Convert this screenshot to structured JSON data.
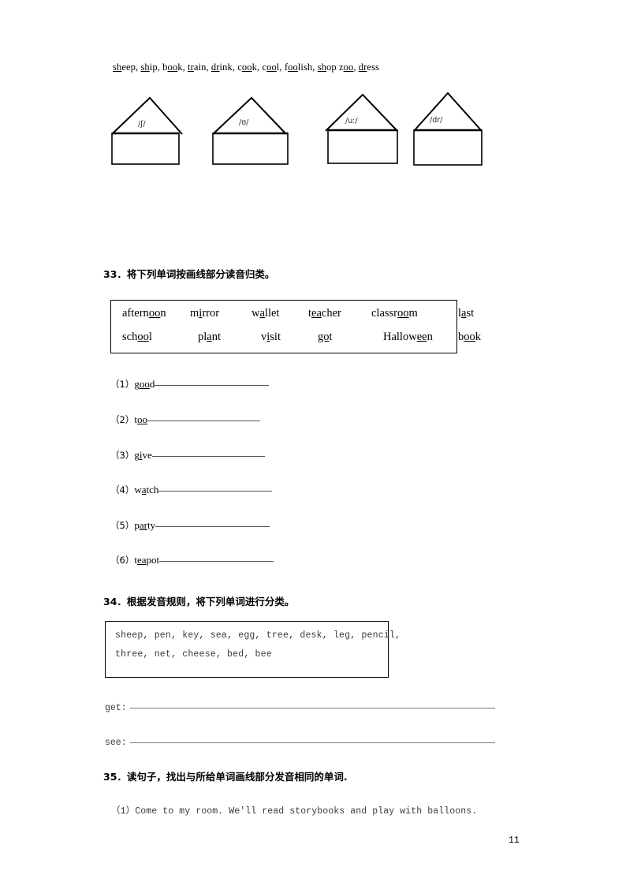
{
  "page": {
    "number": "11"
  },
  "top_word_list": {
    "name": "phonics-word-list",
    "words": [
      {
        "pre": "",
        "mark": "sh",
        "post": "eep",
        "sep": ", "
      },
      {
        "pre": "",
        "mark": "sh",
        "post": "ip",
        "sep": ", "
      },
      {
        "pre": "b",
        "mark": "oo",
        "post": "k",
        "sep": ", "
      },
      {
        "pre": "",
        "mark": "tr",
        "post": "ain",
        "sep": ", "
      },
      {
        "pre": "",
        "mark": "dr",
        "post": "ink",
        "sep": ", "
      },
      {
        "pre": "c",
        "mark": "oo",
        "post": "k",
        "sep": ", "
      },
      {
        "pre": "c",
        "mark": "oo",
        "post": "l",
        "sep": ", "
      },
      {
        "pre": "f",
        "mark": "oo",
        "post": "lish",
        "sep": ", "
      },
      {
        "pre": "",
        "mark": "sh",
        "post": "op",
        "sep": " "
      },
      {
        "pre": "z",
        "mark": "oo",
        "post": "",
        "sep": ", "
      },
      {
        "pre": "",
        "mark": "dr",
        "post": "ess",
        "sep": ""
      }
    ]
  },
  "houses": [
    {
      "name": "house-1",
      "phonetic": "/ʃ/"
    },
    {
      "name": "house-2",
      "phonetic": "/ʊ/"
    },
    {
      "name": "house-3",
      "phonetic": "/uː/"
    },
    {
      "name": "house-4",
      "phonetic": "/dr/"
    }
  ],
  "questions": {
    "q33": {
      "heading": "33．将下列单词按画线部分读音归类。",
      "word_bank": {
        "row1": [
          {
            "pre": "aftern",
            "mark": "oo",
            "post": "n"
          },
          {
            "pre": "m",
            "mark": "i",
            "post": "rror"
          },
          {
            "pre": "w",
            "mark": "a",
            "post": "llet"
          },
          {
            "pre": "t",
            "mark": "ea",
            "post": "cher"
          },
          {
            "pre": "classr",
            "mark": "oo",
            "post": "m"
          },
          {
            "pre": "l",
            "mark": "a",
            "post": "st"
          }
        ],
        "row2": [
          {
            "pre": "sch",
            "mark": "oo",
            "post": "l"
          },
          {
            "pre": "pl",
            "mark": "a",
            "post": "nt"
          },
          {
            "pre": "v",
            "mark": "i",
            "post": "sit"
          },
          {
            "pre": "",
            "mark": "go",
            "post": "t"
          },
          {
            "pre": "Hallow",
            "mark": "ee",
            "post": "n"
          },
          {
            "pre": "b",
            "mark": "oo",
            "post": "k"
          }
        ]
      },
      "items": [
        {
          "num": "（1）",
          "pre": "g",
          "mark": "oo",
          "post": "d",
          "rule_width": 145
        },
        {
          "num": "（2）",
          "pre": "t",
          "mark": "oo",
          "post": "",
          "rule_width": 143
        },
        {
          "num": "（3）",
          "pre": "g",
          "mark": "i",
          "post": "ve",
          "rule_width": 143
        },
        {
          "num": "（4）",
          "pre": "w",
          "mark": "a",
          "post": "tch",
          "rule_width": 144
        },
        {
          "num": "（5）",
          "pre": "p",
          "mark": "ar",
          "post": "ty",
          "rule_width": 145
        },
        {
          "num": "（6）",
          "pre": "t",
          "mark": "ea",
          "post": "pot",
          "rule_width": 145
        }
      ]
    },
    "q34": {
      "heading": "34．根据发音规则，将下列单词进行分类。",
      "word_bank_line1": "sheep, pen, key, sea, egg, tree, desk, leg, pencil,",
      "word_bank_line2": "three, net, cheese, bed, bee",
      "answers": [
        {
          "label": "get:",
          "rule_width": 463
        },
        {
          "label": "see:",
          "rule_width": 463
        }
      ]
    },
    "q35": {
      "heading": "35．读句子，找出与所给单词画线部分发音相同的单词.",
      "sentence": "（1）Come to my room. We'll read storybooks and play with balloons."
    }
  }
}
